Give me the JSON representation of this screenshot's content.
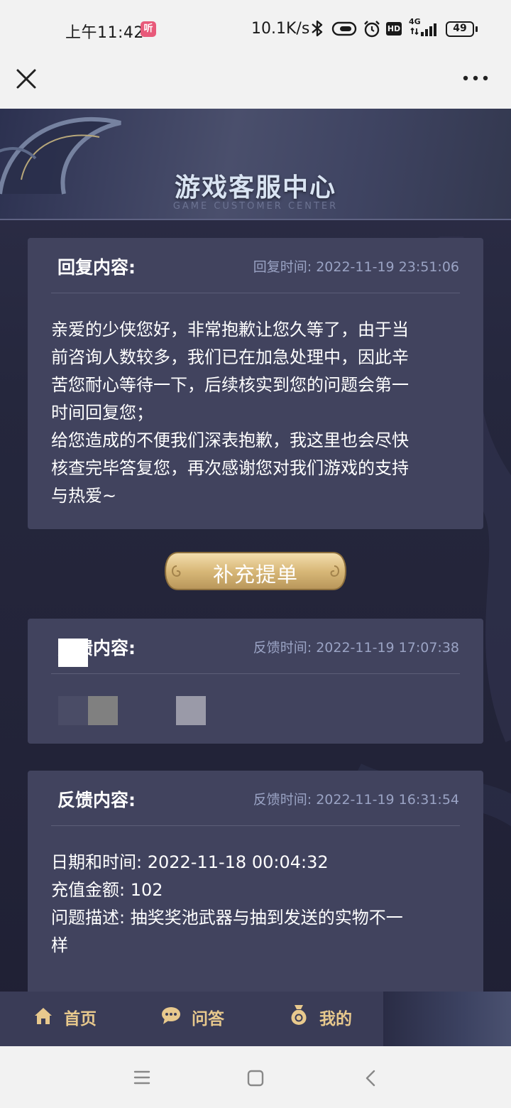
{
  "status_bar": {
    "time": "上午11:42",
    "app_badge": "听",
    "net_speed": "10.1K/s",
    "signal_label": "4G",
    "hd_label": "HD",
    "battery": "49"
  },
  "hero": {
    "title": "游戏客服中心",
    "subtitle": "GAME CUSTOMER CENTER"
  },
  "reply_card": {
    "label": "回复内容:",
    "time_label": "回复时间: 2022-11-19 23:51:06",
    "content": "亲爱的少侠您好，非常抱歉让您久等了，由于当\n前咨询人数较多，我们已在加急处理中，因此辛\n苦您耐心等待一下，后续核实到您的问题会第一\n时间回复您；\n给您造成的不便我们深表抱歉，我这里也会尽快\n核查完毕答复您，再次感谢您对我们游戏的支持\n与热爱~"
  },
  "supplement_button": "补充提单",
  "feedback_card_1": {
    "label": "反馈内容:",
    "time_label": "反馈时间: 2022-11-19 17:07:38"
  },
  "feedback_card_2": {
    "label": "反馈内容:",
    "time_label": "反馈时间: 2022-11-19 16:31:54",
    "content": "日期和时间: 2022-11-18 00:04:32\n充值金额: 102\n问题描述: 抽奖奖池武器与抽到发送的实物不一\n样"
  },
  "tabbar": {
    "items": [
      {
        "label": "首页",
        "icon": "home-icon"
      },
      {
        "label": "问答",
        "icon": "chat-icon"
      },
      {
        "label": "我的",
        "icon": "money-bag-icon"
      }
    ]
  },
  "colors": {
    "accent_gold": "#e8c98d",
    "card_bg": "#41435e",
    "page_bg": "#25273d"
  }
}
